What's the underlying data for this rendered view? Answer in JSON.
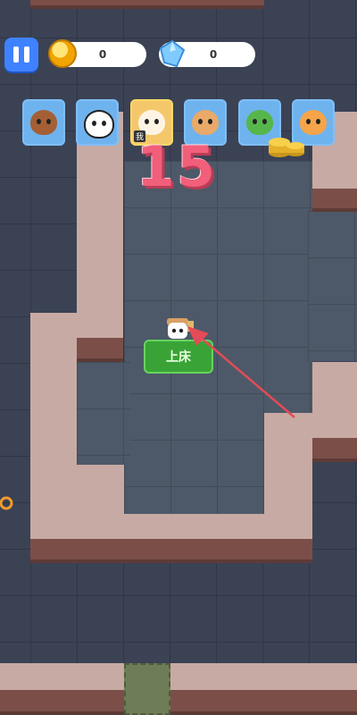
{
  "hud": {
    "coins": "0",
    "gems": "0"
  },
  "countdown": "15",
  "bed_button_label": "上床",
  "avatars": [
    {
      "name": "capybara-avatar"
    },
    {
      "name": "cow-avatar"
    },
    {
      "name": "coffee-cup-avatar",
      "tag": "我"
    },
    {
      "name": "hamster-avatar"
    },
    {
      "name": "tree-avatar"
    },
    {
      "name": "cat-avatar"
    }
  ],
  "colors": {
    "accent_blue": "#3f82ff",
    "countdown_pink": "#f15f7a",
    "bed_green": "#3aa337",
    "wall": "#c7aaa3",
    "floor": "#4d5968"
  }
}
